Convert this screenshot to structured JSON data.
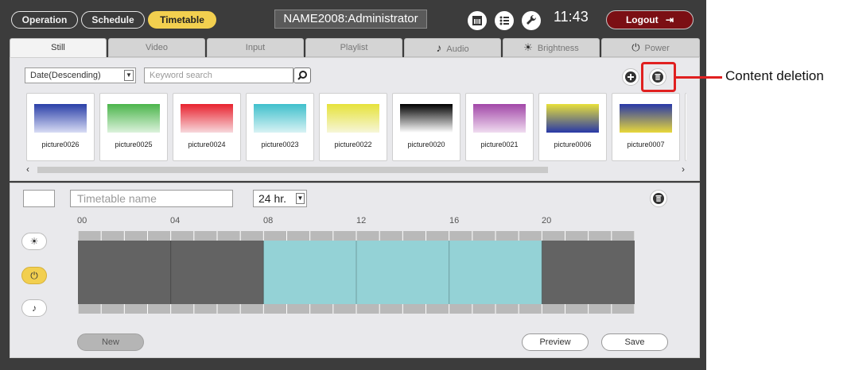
{
  "topbar": {
    "nav": [
      "Operation",
      "Schedule",
      "Timetable"
    ],
    "active_nav": "Timetable",
    "device": "NAME2008:Administrator",
    "icons": [
      "calendar-icon",
      "list-icon",
      "wrench-icon"
    ],
    "time": "11:43",
    "logout": "Logout"
  },
  "tabs": [
    {
      "label": "Still",
      "icon": ""
    },
    {
      "label": "Video",
      "icon": ""
    },
    {
      "label": "Input",
      "icon": ""
    },
    {
      "label": "Playlist",
      "icon": ""
    },
    {
      "label": "Audio",
      "icon": "♪"
    },
    {
      "label": "Brightness",
      "icon": "☀"
    },
    {
      "label": "Power",
      "icon": "⏻"
    }
  ],
  "active_tab": "Still",
  "content": {
    "sort": "Date(Descending)",
    "search_placeholder": "Keyword search",
    "thumbnails": [
      {
        "name": "picture0026",
        "colors": [
          "#2a3fa8",
          "#d8dcf4"
        ]
      },
      {
        "name": "picture0025",
        "colors": [
          "#4bb54b",
          "#dcf2dc"
        ]
      },
      {
        "name": "picture0024",
        "colors": [
          "#e8222e",
          "#f7d8dc"
        ]
      },
      {
        "name": "picture0023",
        "colors": [
          "#3fc0cc",
          "#d8f2f4"
        ]
      },
      {
        "name": "picture0022",
        "colors": [
          "#e6e23a",
          "#f6f6d8"
        ]
      },
      {
        "name": "picture0020",
        "colors": [
          "#000000",
          "#ffffff"
        ]
      },
      {
        "name": "picture0021",
        "colors": [
          "#a247a8",
          "#f0dcf0"
        ]
      },
      {
        "name": "picture0006",
        "colors": [
          "#e8e03a",
          "#2838a8"
        ]
      },
      {
        "name": "picture0007",
        "colors": [
          "#2838a8",
          "#e8d83a"
        ]
      }
    ]
  },
  "timetable": {
    "name_placeholder": "Timetable name",
    "hours": "24 hr.",
    "hour_labels": [
      "00",
      "04",
      "08",
      "12",
      "16",
      "20"
    ],
    "power_on_span": [
      8,
      20
    ],
    "new": "New",
    "preview": "Preview",
    "save": "Save"
  },
  "annotation": "Content deletion",
  "colors": {
    "background": "#3c3c3c",
    "panel": "#e9e9ec",
    "accent": "#f2cf4f",
    "power_on": "#94d2d6",
    "power_off": "#636363",
    "logout": "#7b0f14",
    "callout": "#e02020"
  }
}
